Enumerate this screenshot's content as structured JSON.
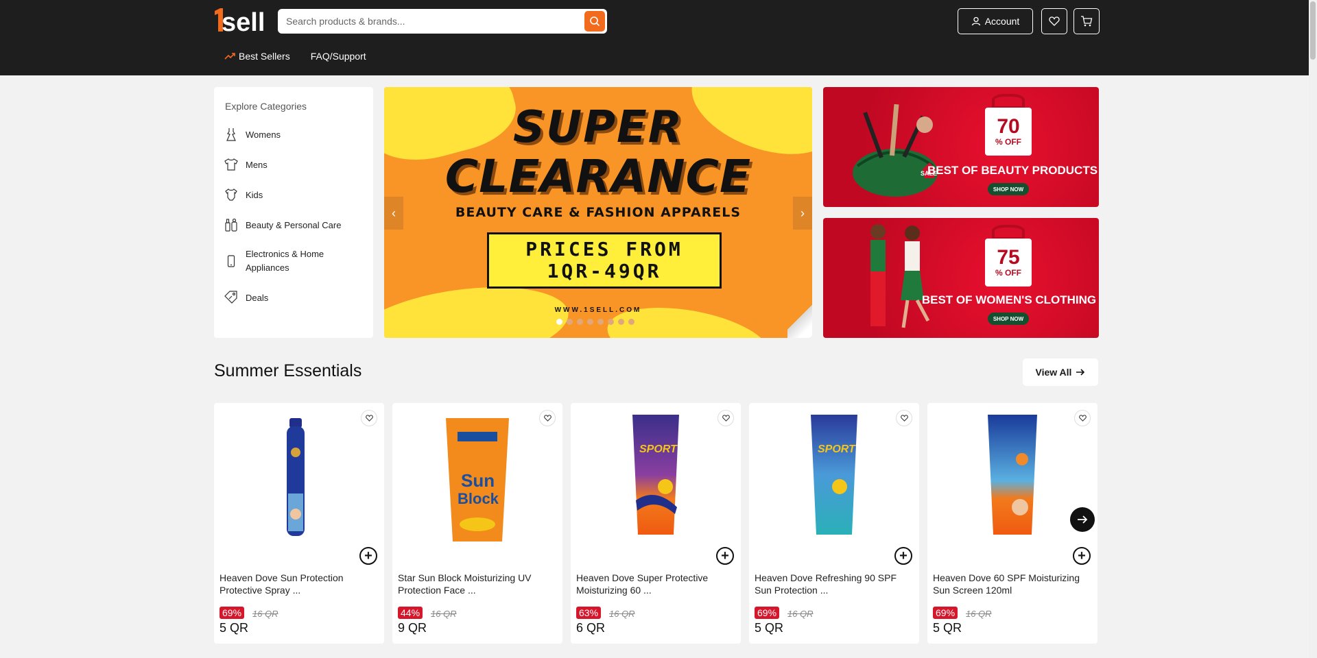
{
  "header": {
    "logo_text": "1sell",
    "search_placeholder": "Search products & brands...",
    "account_label": "Account",
    "nav": [
      {
        "label": "Best Sellers",
        "icon": "trending-up-icon"
      },
      {
        "label": "FAQ/Support"
      }
    ]
  },
  "categories": {
    "title": "Explore Categories",
    "items": [
      {
        "label": "Womens",
        "icon": "dress-icon"
      },
      {
        "label": "Mens",
        "icon": "shirt-icon"
      },
      {
        "label": "Kids",
        "icon": "onesie-icon"
      },
      {
        "label": "Beauty & Personal Care",
        "icon": "cosmetics-icon"
      },
      {
        "label": "Electronics & Home\nAppliances",
        "icon": "phone-icon"
      },
      {
        "label": "Deals",
        "icon": "tag-icon"
      }
    ]
  },
  "hero": {
    "line1": "SUPER",
    "line2": "CLEARANCE",
    "subtitle": "BEAUTY CARE & FASHION APPARELS",
    "price_line1": "PRICES FROM",
    "price_line2": "1QR-49QR",
    "url": "WWW.1SELL.COM",
    "slide_count": 8,
    "active_slide": 1
  },
  "promos": [
    {
      "percent": "70",
      "off": "% OFF",
      "text": "BEST OF BEAUTY PRODUCTS",
      "cta": "SHOP NOW",
      "badge": "SALE"
    },
    {
      "percent": "75",
      "off": "% OFF",
      "text": "BEST OF WOMEN'S CLOTHING",
      "cta": "SHOP NOW"
    }
  ],
  "section": {
    "title": "Summer Essentials",
    "view_all": "View All",
    "products": [
      {
        "name": "Heaven Dove Sun Protection Protective Spray ...",
        "discount": "69%",
        "old_price": "16 QR",
        "price": "5 QR"
      },
      {
        "name": "Star Sun Block Moisturizing UV Protection Face ...",
        "discount": "44%",
        "old_price": "16 QR",
        "price": "9 QR"
      },
      {
        "name": "Heaven Dove Super Protective Moisturizing 60 ...",
        "discount": "63%",
        "old_price": "16 QR",
        "price": "6 QR"
      },
      {
        "name": "Heaven Dove Refreshing 90 SPF Sun Protection ...",
        "discount": "69%",
        "old_price": "16 QR",
        "price": "5 QR"
      },
      {
        "name": "Heaven Dove 60 SPF Moisturizing Sun Screen 120ml",
        "discount": "69%",
        "old_price": "16 QR",
        "price": "5 QR"
      }
    ]
  },
  "colors": {
    "header_bg": "#1e1e1e",
    "accent": "#f26b1d",
    "discount": "#d6162b",
    "promo_red": "#d80c27",
    "hero_orange": "#f99526"
  }
}
